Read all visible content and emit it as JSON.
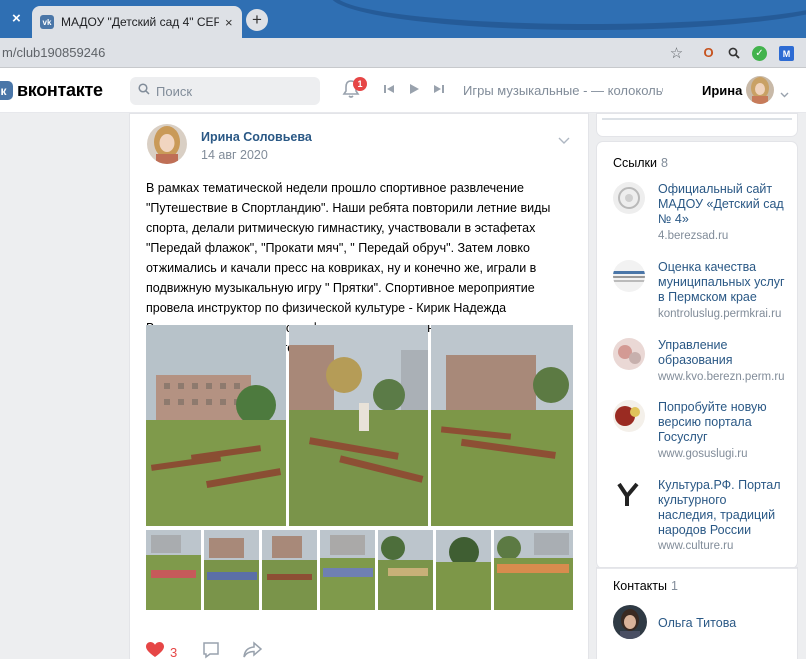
{
  "browser": {
    "tab_title": "МАДОУ \"Детский сад 4\" СЕРЕБР",
    "prev_tab_close": "×",
    "tab_close": "×",
    "new_tab": "+",
    "url": "m/club190859246"
  },
  "header": {
    "logo_text": "вконтакте",
    "search_placeholder": "Поиск",
    "notification_count": "1",
    "now_playing": "Игры музыкальные - — колокольч...",
    "user_name": "Ирина"
  },
  "post": {
    "author": "Ирина Соловьева",
    "date": "14 авг 2020",
    "text": "В рамках тематической недели прошло спортивное развлечение \"Путешествие в Спортландию\". Наши ребята повторили летние виды спорта, делали ритмическую гимнастику, участвовали в эстафетах \"Передай флажок\", \"Прокати мяч\", \" Передай обруч\". Затем ловко отжимались и качали пресс на ковриках, ну и конечно же, играли в подвижную музыкальную игру \" Прятки\". Спортивное мероприятие провела инструктор по физической культуре - Кирик Надежда Васильевна, музыкальное оформление и упражнения под музыку - музыкальный руководитель Соловьёва И. В.",
    "likes": "3",
    "photo_count": 9
  },
  "links": {
    "heading": "Ссылки",
    "count": "8",
    "items": [
      {
        "title": "Официальный сайт МАДОУ «Детский сад № 4»",
        "url": "4.berezsad.ru"
      },
      {
        "title": "Оценка качества муниципальных услуг в Пермском крае",
        "url": "kontroluslug.permkrai.ru"
      },
      {
        "title": "Управление образования",
        "url": "www.kvo.berezn.perm.ru"
      },
      {
        "title": "Попробуйте новую версию портала Госуслуг",
        "url": "www.gosuslugi.ru"
      },
      {
        "title": "Культура.РФ. Портал культурного наследия, традиций народов России",
        "url": "www.culture.ru"
      }
    ]
  },
  "contacts": {
    "heading": "Контакты",
    "count": "1",
    "items": [
      {
        "name": "Ольга Титова"
      }
    ]
  },
  "colors": {
    "vk_blue": "#4a76a8",
    "link": "#2a5885",
    "muted": "#818c99",
    "like_red": "#e64646"
  }
}
